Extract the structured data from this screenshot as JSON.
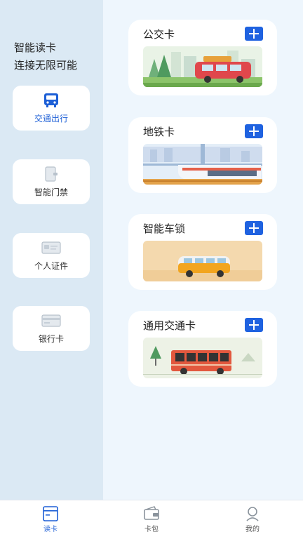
{
  "sidebar": {
    "headline_line1": "智能读卡",
    "headline_line2": "连接无限可能",
    "items": [
      {
        "label": "交通出行",
        "icon": "bus-icon",
        "active": true
      },
      {
        "label": "智能门禁",
        "icon": "door-card-icon",
        "active": false
      },
      {
        "label": "个人证件",
        "icon": "id-card-icon",
        "active": false
      },
      {
        "label": "银行卡",
        "icon": "bank-card-icon",
        "active": false
      }
    ]
  },
  "cards": [
    {
      "title": "公交卡",
      "add_icon": "plus-icon",
      "image": "city-car-illustration"
    },
    {
      "title": "地铁卡",
      "add_icon": "plus-icon",
      "image": "metro-train-illustration"
    },
    {
      "title": "智能车锁",
      "add_icon": "plus-icon",
      "image": "van-illustration"
    },
    {
      "title": "通用交通卡",
      "add_icon": "plus-icon",
      "image": "bus-illustration"
    }
  ],
  "tabbar": {
    "items": [
      {
        "label": "读卡",
        "icon": "card-reader-icon",
        "active": true
      },
      {
        "label": "卡包",
        "icon": "wallet-icon",
        "active": false
      },
      {
        "label": "我的",
        "icon": "profile-icon",
        "active": false
      }
    ]
  },
  "colors": {
    "accent": "#1f62e0",
    "sidebar_bg": "#dbe9f4",
    "main_bg": "#eef6fd"
  }
}
